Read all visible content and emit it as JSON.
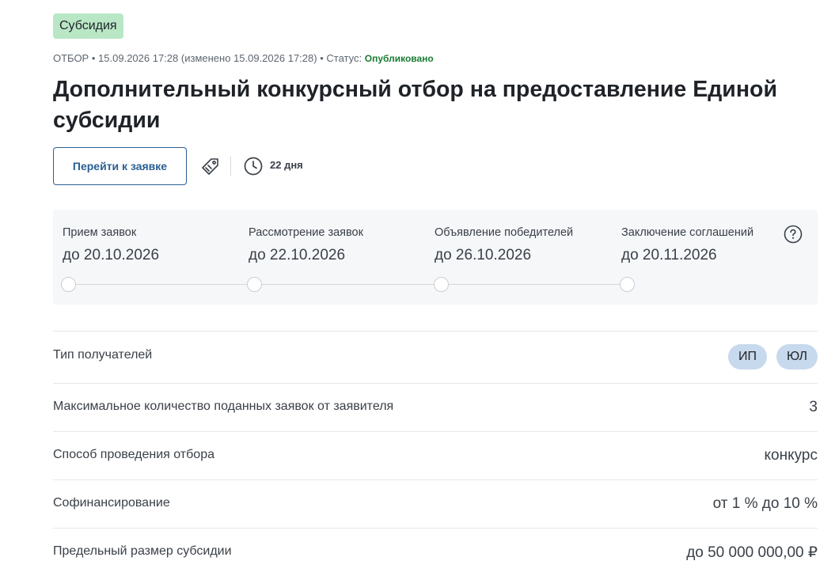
{
  "badge": "Субсидия",
  "meta": {
    "type": "ОТБОР",
    "sep": "•",
    "created": "15.09.2026 17:28",
    "modified": "(изменено 15.09.2026 17:28)",
    "status_label": "Статус:",
    "status_value": "Опубликовано"
  },
  "title": "Дополнительный конкурсный отбор на предоставление Единой субсидии",
  "actions": {
    "apply_label": "Перейти к заявке",
    "days_left": "22 дня"
  },
  "stages": [
    {
      "label": "Прием заявок",
      "date": "до 20.10.2026"
    },
    {
      "label": "Рассмотрение заявок",
      "date": "до 22.10.2026"
    },
    {
      "label": "Объявление победителей",
      "date": "до 26.10.2026"
    },
    {
      "label": "Заключение соглашений",
      "date": "до 20.11.2026"
    }
  ],
  "details": {
    "recipients": {
      "label": "Тип получателей",
      "chips": [
        "ИП",
        "ЮЛ"
      ]
    },
    "max_applications": {
      "label": "Максимальное количество поданных заявок от заявителя",
      "value": "3"
    },
    "method": {
      "label": "Способ проведения отбора",
      "value": "конкурс"
    },
    "cofinancing": {
      "label": "Софинансирование",
      "value": "от 1 % до 10 %"
    },
    "limit": {
      "label": "Предельный размер субсидии",
      "value": "до 50 000 000,00 ₽"
    }
  },
  "colors": {
    "badge_bg": "#b9e7c6",
    "status_green": "#1a7c32",
    "button_blue": "#2a5f93",
    "chip_bg": "#c7d9ec"
  }
}
